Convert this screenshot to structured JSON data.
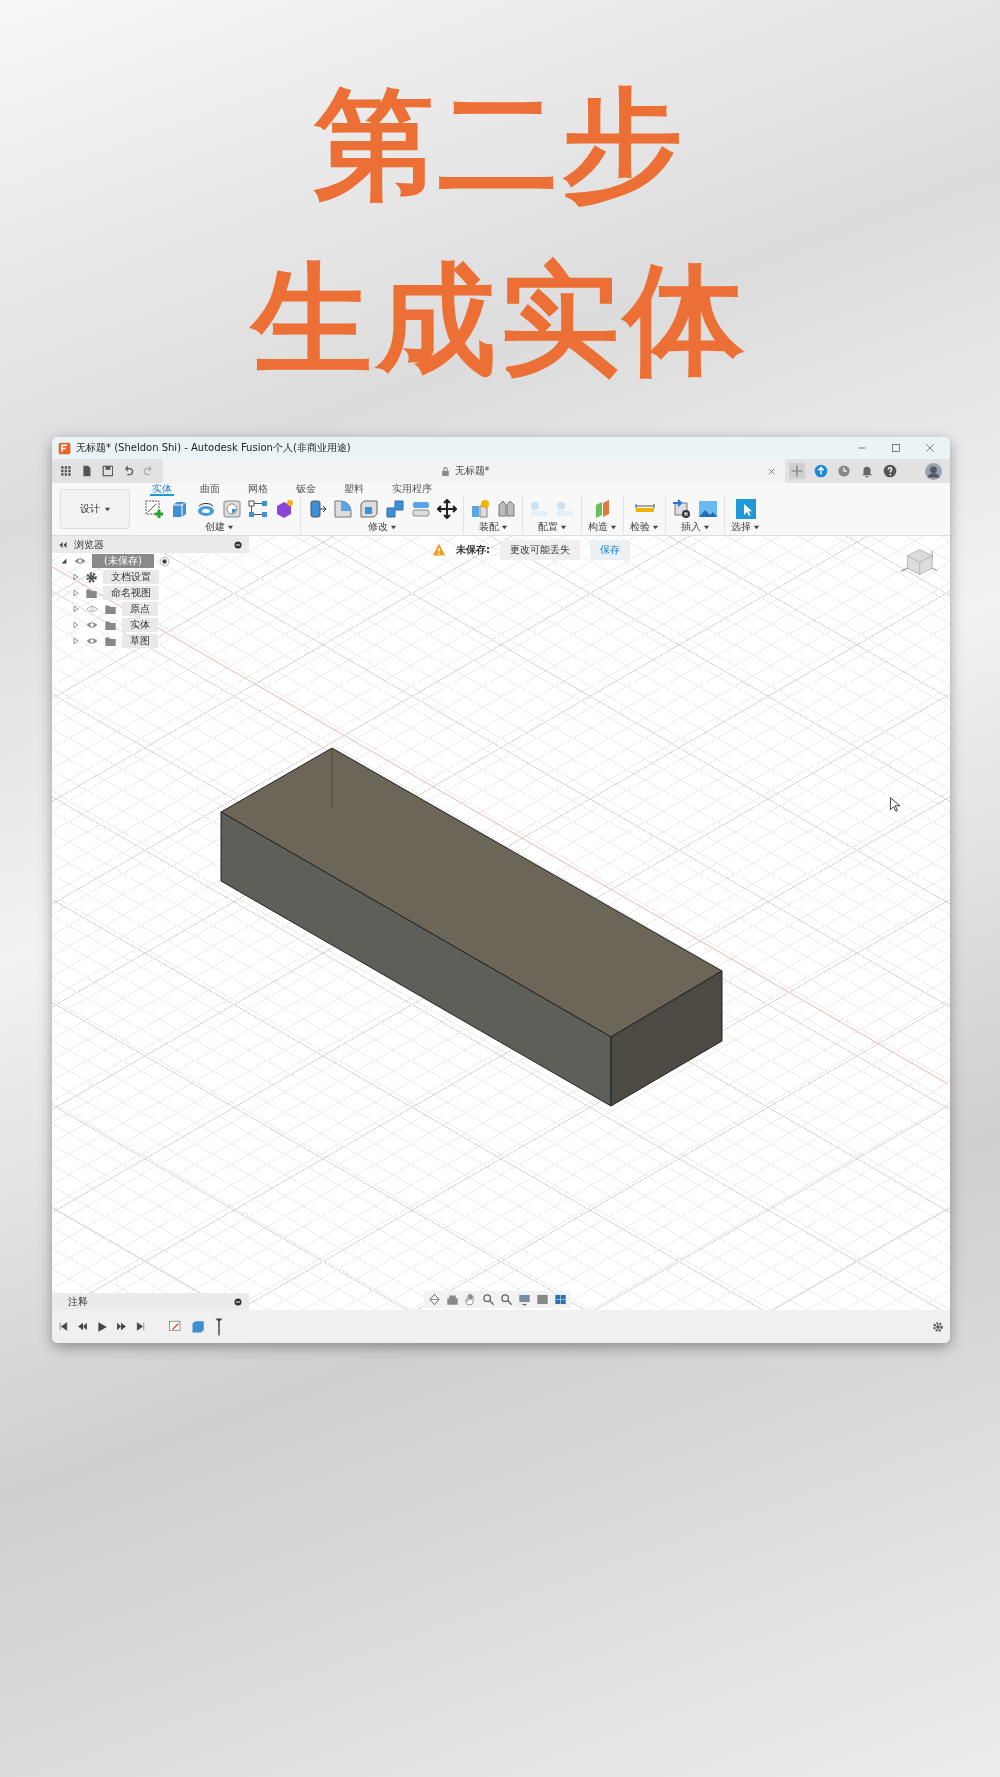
{
  "headline": [
    "第二步",
    "生成实体"
  ],
  "window": {
    "title": "无标题* (Sheldon Shi) - Autodesk Fusion个人(非商业用途)"
  },
  "document_tab": {
    "title": "无标题*"
  },
  "workspace": {
    "label": "设计"
  },
  "tabs": [
    {
      "label": "实体",
      "selected": true
    },
    {
      "label": "曲面",
      "selected": false
    },
    {
      "label": "网格",
      "selected": false
    },
    {
      "label": "钣金",
      "selected": false
    },
    {
      "label": "塑料",
      "selected": false
    },
    {
      "label": "实用程序",
      "selected": false
    }
  ],
  "tool_groups": [
    "创建",
    "修改",
    "装配",
    "配置",
    "构造",
    "检验",
    "插入",
    "选择"
  ],
  "browser": {
    "title": "浏览器",
    "root": {
      "label": "(未保存)",
      "visible": true,
      "children": [
        {
          "label": "文档设置",
          "kind": "settings"
        },
        {
          "label": "命名视图",
          "kind": "folder"
        },
        {
          "label": "原点",
          "kind": "folder",
          "visible": false
        },
        {
          "label": "实体",
          "kind": "folder",
          "visible": true
        },
        {
          "label": "草图",
          "kind": "folder",
          "visible": true
        }
      ]
    }
  },
  "unsaved_banner": {
    "label": "未保存:",
    "message": "更改可能丢失",
    "button": "保存"
  },
  "comments_panel": {
    "title": "注释"
  }
}
